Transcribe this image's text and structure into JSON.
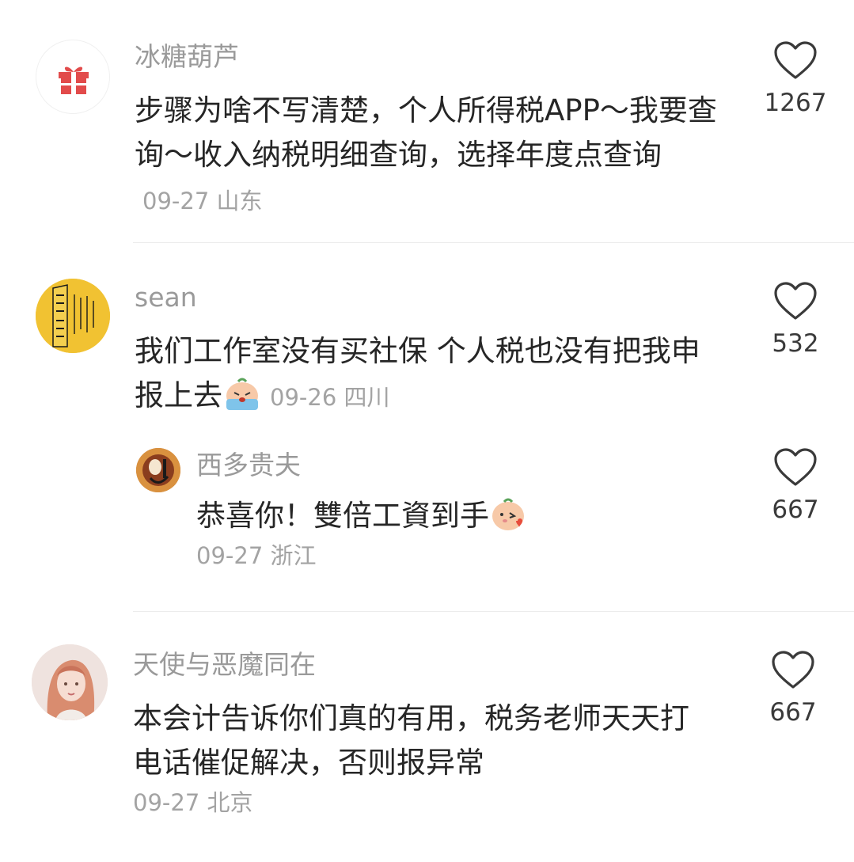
{
  "comments": [
    {
      "username": "冰糖葫芦",
      "text": "步骤为啥不写清楚，个人所得税APP～我要查询～收入纳税明细查询，选择年度点查询",
      "time": "09-27",
      "location": "山东",
      "likes": "1267",
      "avatar_icon": "gift-icon"
    },
    {
      "username": "sean",
      "text": "我们工作室没有买社保 个人税也没有把我申报上去",
      "emoji": "crying-emoji-icon",
      "time": "09-26",
      "location": "四川",
      "likes": "532",
      "avatar_icon": "talisman-avatar",
      "reply": {
        "username": "西多贵夫",
        "text": "恭喜你！雙倍工資到手",
        "emoji": "kiss-emoji-icon",
        "time": "09-27",
        "location": "浙江",
        "likes": "667"
      }
    },
    {
      "username": "天使与恶魔同在",
      "text": "本会计告诉你们真的有用，税务老师天天打电话催促解决，否则报异常",
      "time": "09-27",
      "location": "北京",
      "likes": "667",
      "avatar_icon": "portrait-avatar"
    }
  ],
  "colors": {
    "username": "#9a9a9a",
    "text": "#262626",
    "meta": "#a3a3a3",
    "talisman_yellow": "#f1c232"
  }
}
